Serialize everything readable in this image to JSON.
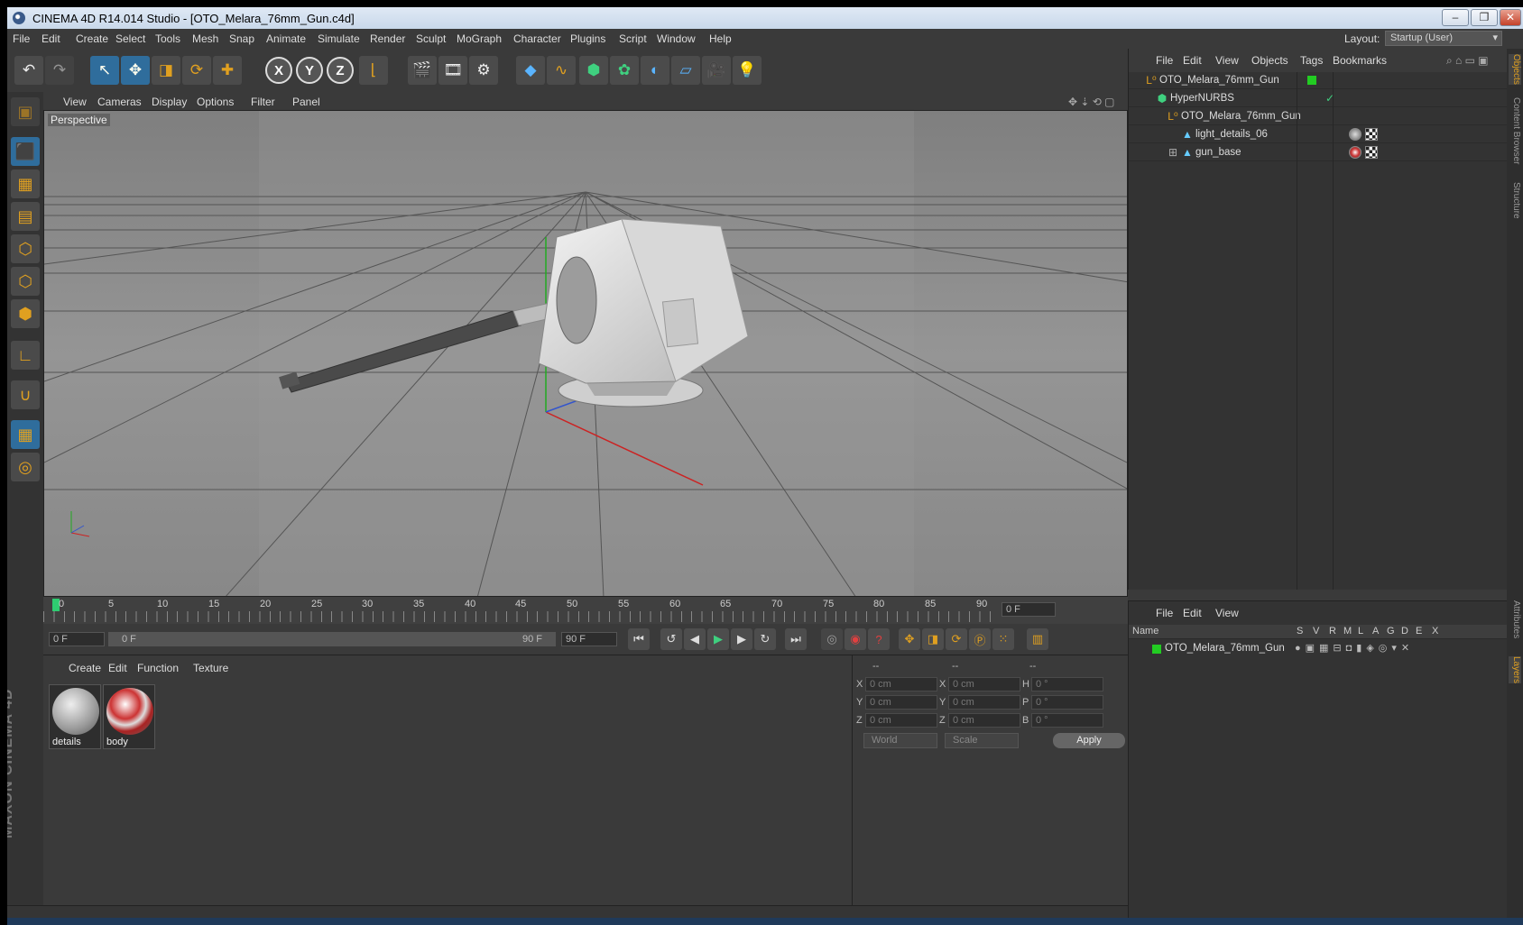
{
  "window": {
    "title": "CINEMA 4D R14.014 Studio - [OTO_Melara_76mm_Gun.c4d]"
  },
  "menu": [
    "File",
    "Edit",
    "Create",
    "Select",
    "Tools",
    "Mesh",
    "Snap",
    "Animate",
    "Simulate",
    "Render",
    "Sculpt",
    "MoGraph",
    "Character",
    "Plugins",
    "Script",
    "Window",
    "Help"
  ],
  "layout": {
    "label": "Layout:",
    "value": "Startup (User)"
  },
  "viewport": {
    "menu": [
      "View",
      "Cameras",
      "Display",
      "Options",
      "Filter",
      "Panel"
    ],
    "label": "Perspective"
  },
  "timeline": {
    "ticks": [
      "0",
      "5",
      "10",
      "15",
      "20",
      "25",
      "30",
      "35",
      "40",
      "45",
      "50",
      "55",
      "60",
      "65",
      "70",
      "75",
      "80",
      "85",
      "90"
    ],
    "current": "0 F",
    "start": "0 F",
    "range_start": "0 F",
    "range_end": "90 F",
    "end": "90 F"
  },
  "materials": {
    "menu": [
      "Create",
      "Edit",
      "Function",
      "Texture"
    ],
    "items": [
      {
        "name": "details"
      },
      {
        "name": "body"
      }
    ]
  },
  "coordinates": {
    "headers": [
      "--",
      "--",
      "--"
    ],
    "rows": [
      {
        "a": "X",
        "v1": "0 cm",
        "b": "X",
        "v2": "0 cm",
        "c": "H",
        "v3": "0 °"
      },
      {
        "a": "Y",
        "v1": "0 cm",
        "b": "Y",
        "v2": "0 cm",
        "c": "P",
        "v3": "0 °"
      },
      {
        "a": "Z",
        "v1": "0 cm",
        "b": "Z",
        "v2": "0 cm",
        "c": "B",
        "v3": "0 °"
      }
    ],
    "space": "World",
    "mode": "Scale",
    "apply": "Apply"
  },
  "objects": {
    "menu": [
      "File",
      "Edit",
      "View",
      "Objects",
      "Tags",
      "Bookmarks"
    ],
    "tree": [
      {
        "name": "OTO_Melara_76mm_Gun",
        "indent": 0
      },
      {
        "name": "HyperNURBS",
        "indent": 1
      },
      {
        "name": "OTO_Melara_76mm_Gun",
        "indent": 2
      },
      {
        "name": "light_details_06",
        "indent": 3
      },
      {
        "name": "gun_base",
        "indent": 3
      }
    ]
  },
  "layers": {
    "menu": [
      "File",
      "Edit",
      "View"
    ],
    "columns": [
      "Name",
      "S",
      "V",
      "R",
      "M",
      "L",
      "A",
      "G",
      "D",
      "E",
      "X"
    ],
    "items": [
      {
        "name": "OTO_Melara_76mm_Gun"
      }
    ]
  },
  "right_tabs": [
    "Objects",
    "Content Browser",
    "Structure",
    "Attributes",
    "Layers"
  ],
  "brand": "MAXON CINEMA 4D",
  "colors": {
    "accent": "#2f6d9c",
    "layer": "#22cc22",
    "x_axis": "#cc2222",
    "y_axis": "#22aa22",
    "z_axis": "#3355cc"
  }
}
